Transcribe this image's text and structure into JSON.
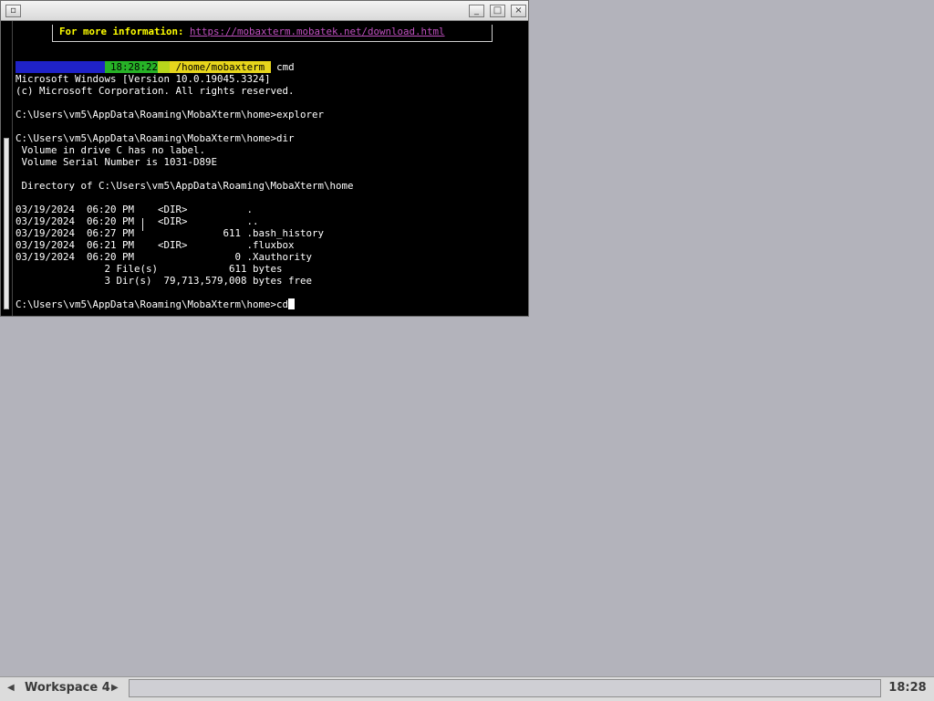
{
  "window": {
    "buttons": {
      "menu": "▫",
      "minimize": "_",
      "maximize": "□",
      "close": "×"
    }
  },
  "terminal": {
    "info_label": "For more information: ",
    "info_link": "https://mobaxterm.mobatek.net/download.html",
    "prompt_bar": {
      "seg1": "               ",
      "seg2": " ",
      "time": "18:28:22",
      "seg3": "  ",
      "path": " /home/mobaxterm ",
      "cmd": " cmd"
    },
    "lines": [
      "Microsoft Windows [Version 10.0.19045.3324]",
      "(c) Microsoft Corporation. All rights reserved.",
      "",
      "C:\\Users\\vm5\\AppData\\Roaming\\MobaXterm\\home>explorer",
      "",
      "C:\\Users\\vm5\\AppData\\Roaming\\MobaXterm\\home>dir",
      " Volume in drive C has no label.",
      " Volume Serial Number is 1031-D89E",
      "",
      " Directory of C:\\Users\\vm5\\AppData\\Roaming\\MobaXterm\\home",
      "",
      "03/19/2024  06:20 PM    <DIR>          .",
      "03/19/2024  06:20 PM    <DIR>          ..",
      "03/19/2024  06:27 PM               611 .bash_history",
      "03/19/2024  06:21 PM    <DIR>          .fluxbox",
      "03/19/2024  06:20 PM                 0 .Xauthority",
      "               2 File(s)            611 bytes",
      "               3 Dir(s)  79,713,579,008 bytes free",
      ""
    ],
    "current_prompt": "C:\\Users\\vm5\\AppData\\Roaming\\MobaXterm\\home>cd"
  },
  "taskbar": {
    "workspace": "Workspace 4",
    "prev": "◀",
    "next": "▶",
    "clock": "18:28"
  }
}
